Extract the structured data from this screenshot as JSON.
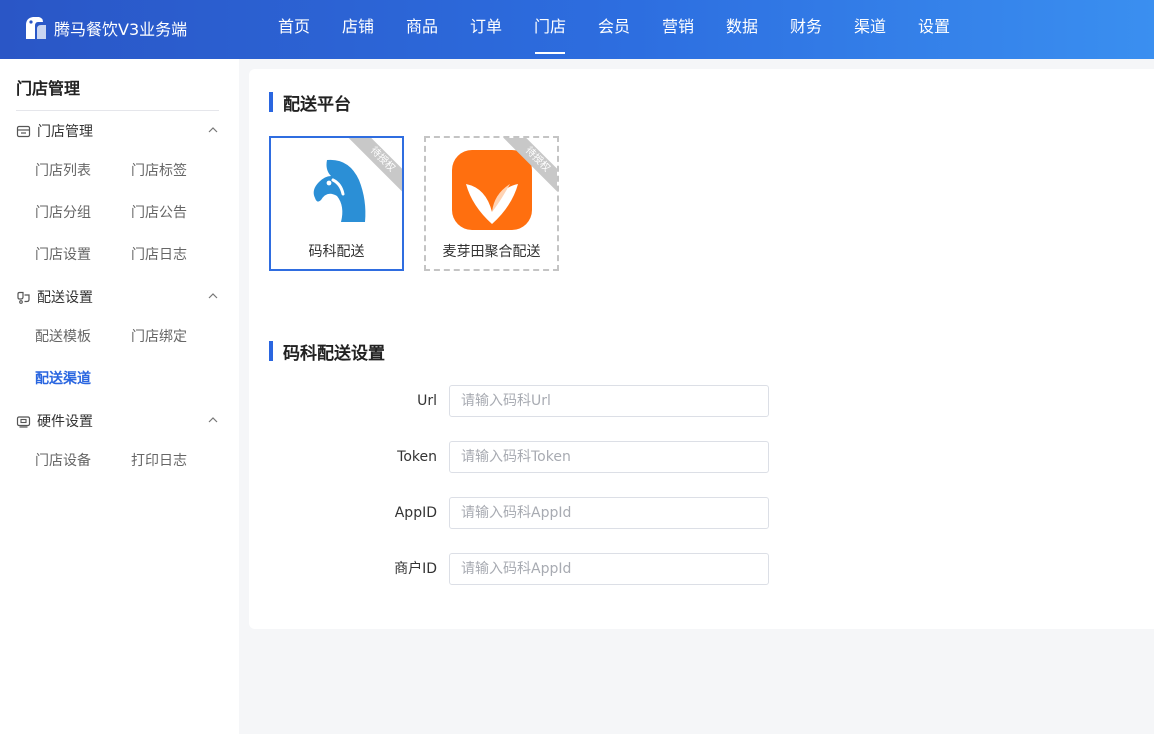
{
  "header": {
    "app_name": "腾马餐饮V3业务端",
    "nav": [
      {
        "label": "首页"
      },
      {
        "label": "店铺"
      },
      {
        "label": "商品"
      },
      {
        "label": "订单"
      },
      {
        "label": "门店",
        "active": true
      },
      {
        "label": "会员"
      },
      {
        "label": "营销"
      },
      {
        "label": "数据"
      },
      {
        "label": "财务"
      },
      {
        "label": "渠道"
      },
      {
        "label": "设置"
      }
    ]
  },
  "sidebar": {
    "title": "门店管理",
    "groups": [
      {
        "label": "门店管理",
        "icon": "store-icon",
        "expanded": true,
        "items": [
          {
            "label": "门店列表"
          },
          {
            "label": "门店标签"
          },
          {
            "label": "门店分组"
          },
          {
            "label": "门店公告"
          },
          {
            "label": "门店设置"
          },
          {
            "label": "门店日志"
          }
        ]
      },
      {
        "label": "配送设置",
        "icon": "delivery-icon",
        "expanded": true,
        "items": [
          {
            "label": "配送模板"
          },
          {
            "label": "门店绑定"
          },
          {
            "label": "配送渠道",
            "active": true
          }
        ]
      },
      {
        "label": "硬件设置",
        "icon": "hardware-icon",
        "expanded": true,
        "items": [
          {
            "label": "门店设备"
          },
          {
            "label": "打印日志"
          }
        ]
      }
    ]
  },
  "main": {
    "platform_section_title": "配送平台",
    "platforms": [
      {
        "name": "码科配送",
        "badge": "待授权",
        "selected": true,
        "logo_color": "#2b8fd6"
      },
      {
        "name": "麦芽田聚合配送",
        "badge": "待授权",
        "selected": false,
        "logo_color": "#ff6f0f"
      }
    ],
    "settings_section_title": "码科配送设置",
    "form": [
      {
        "label": "Url",
        "value": "",
        "placeholder": "请输入码科Url"
      },
      {
        "label": "Token",
        "value": "",
        "placeholder": "请输入码科Token"
      },
      {
        "label": "AppID",
        "value": "",
        "placeholder": "请输入码科AppId"
      },
      {
        "label": "商户ID",
        "value": "",
        "placeholder": "请输入码科AppId"
      }
    ]
  },
  "colors": {
    "accent": "#2a66e0",
    "header_start": "#2a56c6",
    "header_end": "#3a8ff0"
  }
}
